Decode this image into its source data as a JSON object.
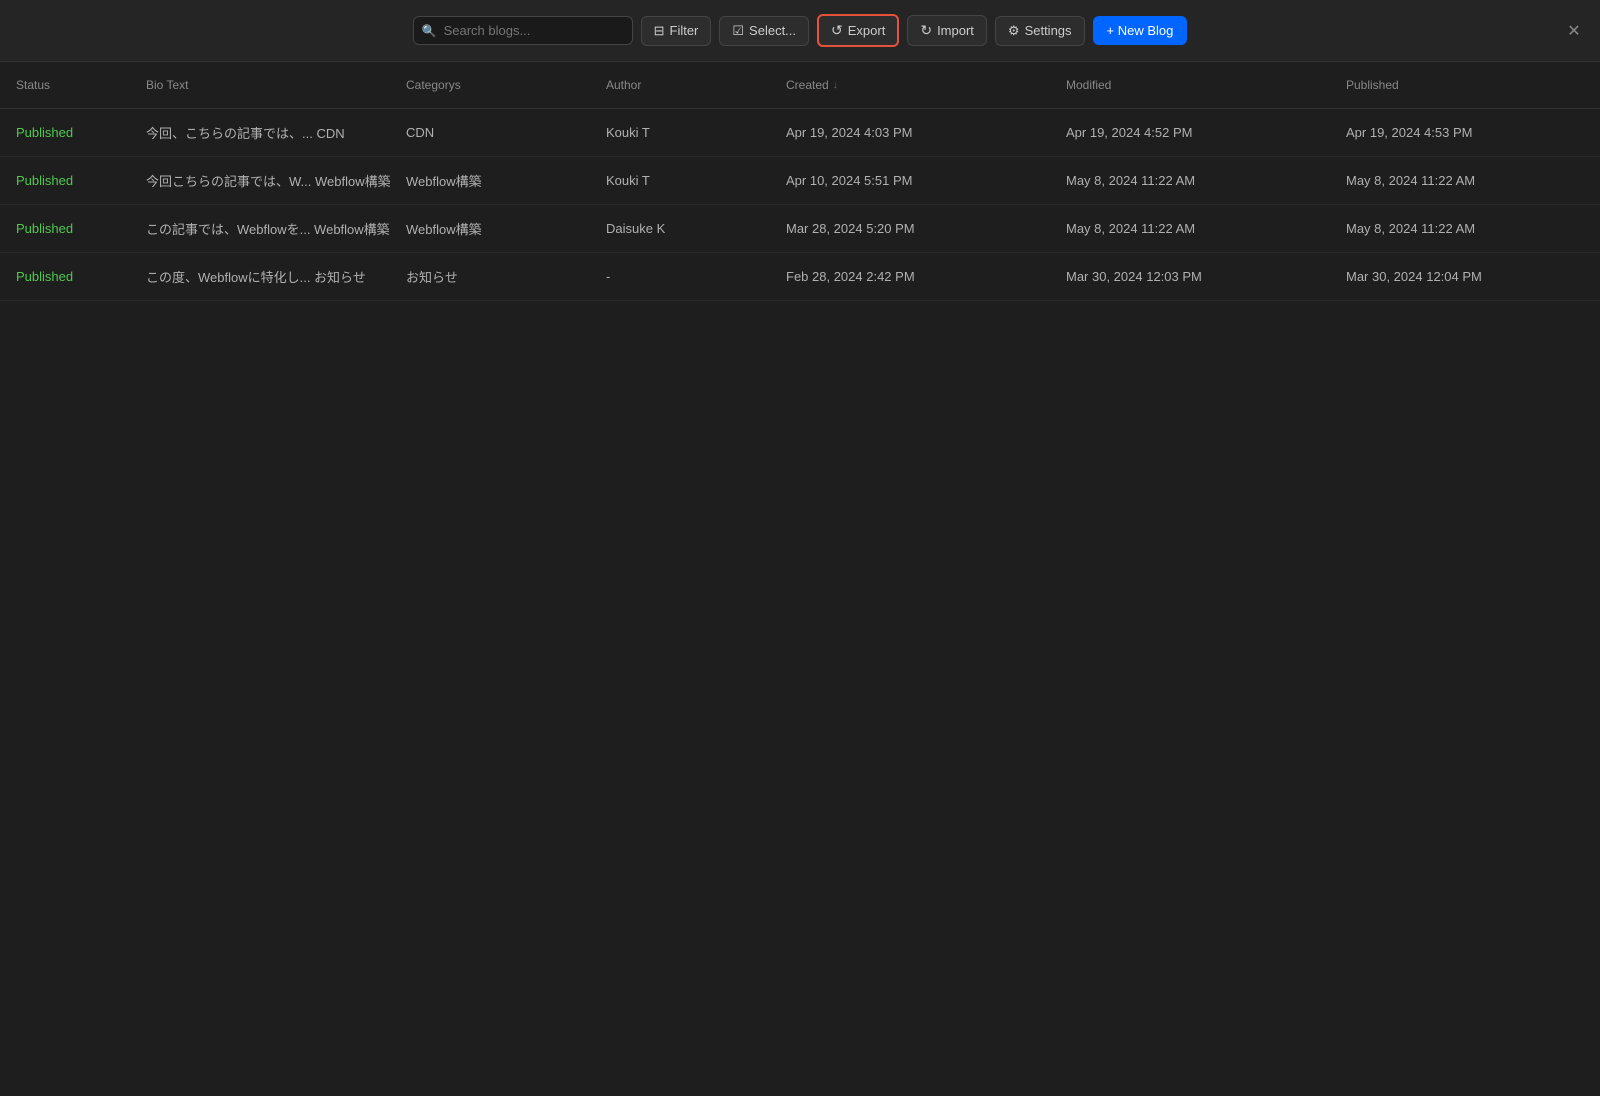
{
  "toolbar": {
    "search_placeholder": "Search blogs...",
    "filter_label": "Filter",
    "select_label": "Select...",
    "export_label": "Export",
    "import_label": "Import",
    "settings_label": "Settings",
    "new_blog_label": "+ New Blog"
  },
  "table": {
    "columns": [
      {
        "key": "status",
        "label": "Status"
      },
      {
        "key": "bio_text",
        "label": "Bio Text"
      },
      {
        "key": "categorys",
        "label": "Categorys"
      },
      {
        "key": "author",
        "label": "Author"
      },
      {
        "key": "created",
        "label": "Created",
        "sortable": true
      },
      {
        "key": "modified",
        "label": "Modified"
      },
      {
        "key": "published",
        "label": "Published"
      }
    ],
    "rows": [
      {
        "status": "Published",
        "bio_text": "今回、こちらの記事では、... CDN",
        "categorys": "CDN",
        "author": "Kouki T",
        "created": "Apr 19, 2024 4:03 PM",
        "modified": "Apr 19, 2024 4:52 PM",
        "published": "Apr 19, 2024 4:53 PM"
      },
      {
        "status": "Published",
        "bio_text": "今回こちらの記事では、W... Webflow構築",
        "categorys": "Webflow構築",
        "author": "Kouki T",
        "created": "Apr 10, 2024 5:51 PM",
        "modified": "May 8, 2024 11:22 AM",
        "published": "May 8, 2024 11:22 AM"
      },
      {
        "status": "Published",
        "bio_text": "この記事では、Webflowを... Webflow構築",
        "categorys": "Webflow構築",
        "author": "Daisuke K",
        "created": "Mar 28, 2024 5:20 PM",
        "modified": "May 8, 2024 11:22 AM",
        "published": "May 8, 2024 11:22 AM"
      },
      {
        "status": "Published",
        "bio_text": "この度、Webflowに特化し... お知らせ",
        "categorys": "お知らせ",
        "author": "-",
        "created": "Feb 28, 2024 2:42 PM",
        "modified": "Mar 30, 2024 12:03 PM",
        "published": "Mar 30, 2024 12:04 PM"
      }
    ]
  },
  "icons": {
    "close": "✕",
    "search": "🔍",
    "filter": "⊟",
    "select": "☑",
    "export": "↺",
    "import": "↻",
    "settings": "⚙",
    "sort_down": "↓",
    "plus": "+"
  }
}
